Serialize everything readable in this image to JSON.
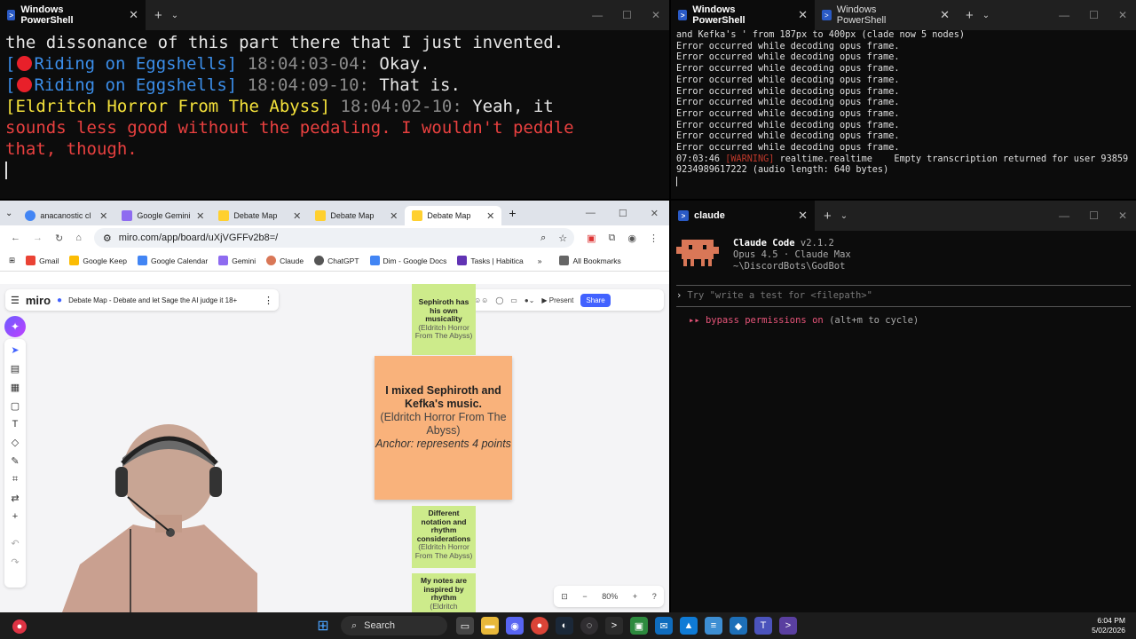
{
  "term1": {
    "tab_title": "Windows PowerShell",
    "lines": [
      {
        "text": "the dissonance of this part there that I just invented."
      },
      {
        "speaker": "[ Riding on Eggshells]",
        "time": "18:04:03-04:",
        "msg": "Okay."
      },
      {
        "speaker": "[ Riding on Eggshells]",
        "time": "18:04:09-10:",
        "msg": "That is."
      },
      {
        "speaker2": "[Eldritch Horror From The Abyss]",
        "time": "18:04:02-10:",
        "msg": "Yeah, it"
      },
      {
        "red": "sounds less good without the pedaling. I wouldn't peddle"
      },
      {
        "red": "that, though."
      }
    ]
  },
  "term2": {
    "tab1": "Windows PowerShell",
    "tab2": "Windows PowerShell",
    "lines": [
      "and Kefka's ' from 187px to 400px (clade now 5 nodes)",
      "Error occurred while decoding opus frame.",
      "Error occurred while decoding opus frame.",
      "Error occurred while decoding opus frame.",
      "Error occurred while decoding opus frame.",
      "Error occurred while decoding opus frame.",
      "Error occurred while decoding opus frame.",
      "Error occurred while decoding opus frame.",
      "Error occurred while decoding opus frame.",
      "Error occurred while decoding opus frame.",
      "Error occurred while decoding opus frame."
    ],
    "warn_time": "07:03:46",
    "warn_tag": "[WARNING]",
    "warn_msg": "realtime.realtime    Empty transcription returned for user 93859",
    "warn_msg2": "9234989617222 (audio length: 640 bytes)"
  },
  "browser": {
    "tabs": [
      {
        "label": "anacanostic cl",
        "color": "#4285f4"
      },
      {
        "label": "Google Gemini",
        "color": "#8e6bf0"
      },
      {
        "label": "Debate Map",
        "color": "#ffd02f"
      },
      {
        "label": "Debate Map",
        "color": "#ffd02f"
      },
      {
        "label": "Debate Map",
        "color": "#ffd02f"
      }
    ],
    "url": "miro.com/app/board/uXjVGFFv2b8=/",
    "bookmarks": [
      "Gmail",
      "Google Keep",
      "Google Calendar",
      "Gemini",
      "Claude",
      "ChatGPT",
      "Dim - Google Docs",
      "Tasks | Habitica"
    ],
    "all_bookmarks": "All Bookmarks"
  },
  "miro": {
    "logo": "miro",
    "board_title": "Debate Map - Debate and let Sage the AI judge it 18+",
    "present": "Present",
    "share": "Share",
    "zoom": "80%",
    "note_top": {
      "title": "Sephiroth has his own musicality",
      "sub": "(Eldritch Horror From The Abyss)"
    },
    "big": {
      "title": "I mixed Sephiroth and Kefka's music.",
      "sub": "(Eldritch Horror From The Abyss)",
      "anchor": "Anchor: represents 4 points"
    },
    "note_mid": {
      "title": "Different notation and rhythm considerations",
      "sub": "(Eldritch Horror From The Abyss)"
    },
    "note_bot": {
      "title": "My notes are inspired by rhythm",
      "sub": "(Eldritch"
    }
  },
  "claude": {
    "tab": "claude",
    "title": "Claude Code",
    "version": "v2.1.2",
    "model": "Opus 4.5 · Claude Max",
    "path": "~\\DiscordBots\\GodBot",
    "placeholder": "Try \"write a test for <filepath>\"",
    "bypass": "bypass permissions on",
    "bypass_hint": "(alt+m to cycle)"
  },
  "taskbar": {
    "search": "Search",
    "time": "6:04 PM",
    "date": "5/02/2026"
  }
}
